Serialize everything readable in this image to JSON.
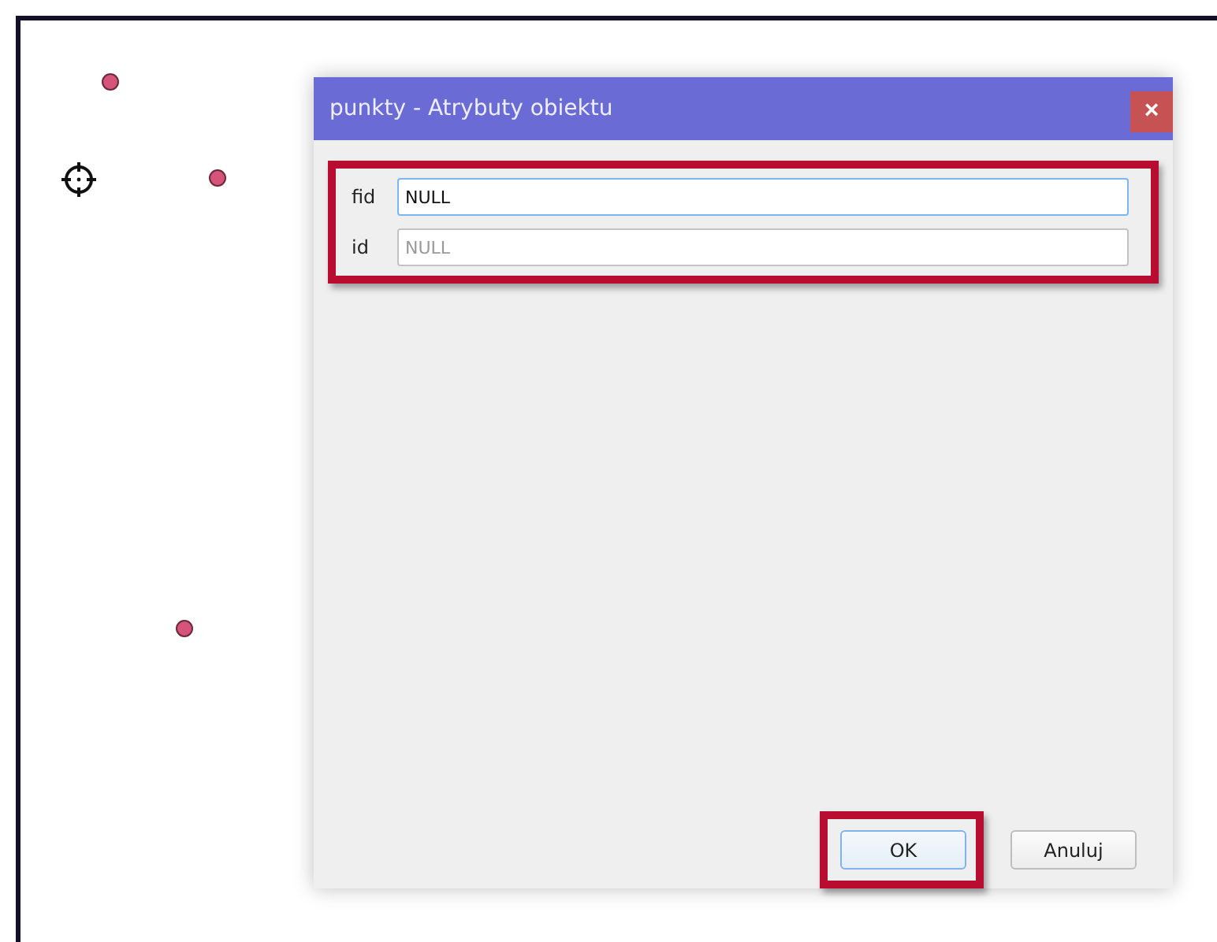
{
  "dialog": {
    "title": "punkty - Atrybuty obiektu",
    "close": "×"
  },
  "form": {
    "highlighted": true,
    "fields": [
      {
        "label": "fid",
        "value": "NULL",
        "focused": true
      },
      {
        "label": "id",
        "placeholder": "NULL",
        "focused": false
      }
    ]
  },
  "buttons": [
    {
      "label": "OK",
      "default": true,
      "highlighted": true
    },
    {
      "label": "Anuluj",
      "default": false,
      "highlighted": false
    }
  ]
}
